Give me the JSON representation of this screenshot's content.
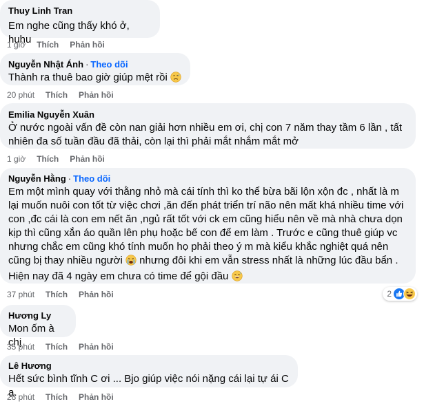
{
  "comments": [
    {
      "author": "Thuy Linh Tran",
      "text": "Em nghe cũng thấy khó ở, huhu",
      "time": "1 giờ",
      "like": "Thích",
      "reply": "Phản hồi"
    },
    {
      "author": "Nguyễn Nhật Ánh",
      "separator": "·",
      "follow": "Theo dõi",
      "text": "Thành ra thuê bao giờ giúp mệt rồi",
      "time": "20 phút",
      "like": "Thích",
      "reply": "Phản hồi"
    },
    {
      "author": "Emilia Nguyễn Xuân",
      "lines": [
        "Ở nước ngoài vấn đề còn nan giải hơn nhiều em ơi, chị con 7 năm thay tầm 6 lần , tất",
        "nhiên đa số tuần đầu đã thải, còn lại thì phải mắt nhắm mắt mở"
      ],
      "time": "1 giờ",
      "like": "Thích",
      "reply": "Phản hồi"
    },
    {
      "author": "Nguyễn Hằng",
      "separator": "·",
      "follow": "Theo dõi",
      "lines": [
        "Em một mình quay với thằng nhỏ mà cái tính thì ko thể bừa bãi lộn xộn đc , nhất là m",
        "lại muốn nuôi con tốt từ việc chơi ,ăn đến phát triển trí não nên mất khá nhiều time với",
        "con ,đc cái là con em nết ăn ,ngủ rất tốt với ck em cũng hiểu nên về mà nhà chưa dọn",
        "kịp thì cũng xắn áo quần lên phụ hoặc bế con để em làm . Trước e cũng thuê giúp vc",
        "nhưng chắc em cũng khó tính muốn họ phải theo ý m mà kiểu khắc nghiệt quá nên",
        "cũng bị thay nhiều người",
        "nhưng đôi khi em vẫn stress nhất là những lúc đầu bẩn .",
        "Hiện nay đã 4 ngày em chưa có time để gội đầu"
      ],
      "time": "37 phút",
      "like": "Thích",
      "reply": "Phản hồi",
      "reaction_count": "2"
    },
    {
      "author": "Hương Ly",
      "text": "Mon ốm à chị",
      "time": "35 phút",
      "like": "Thích",
      "reply": "Phản hồi"
    },
    {
      "author": "Lê Hương",
      "text": "Hết sức bình tĩnh C ơi ... Bjo giúp việc nói nặng cái lại tự ái C ạ.",
      "time": "28 phút",
      "like": "Thích",
      "reply": "Phản hồi"
    }
  ],
  "icons": {
    "sweat_emoji": "anxious-sweat-emoji-icon",
    "crying_emoji": "crying-emoji-icon",
    "grin_emoji": "grinning-sweat-emoji-icon",
    "like_reaction": "like-reaction-icon",
    "haha_reaction": "haha-reaction-icon"
  },
  "colors": {
    "bubble": "#f0f2f5",
    "follow": "#0866ff",
    "meta": "#65676b"
  }
}
